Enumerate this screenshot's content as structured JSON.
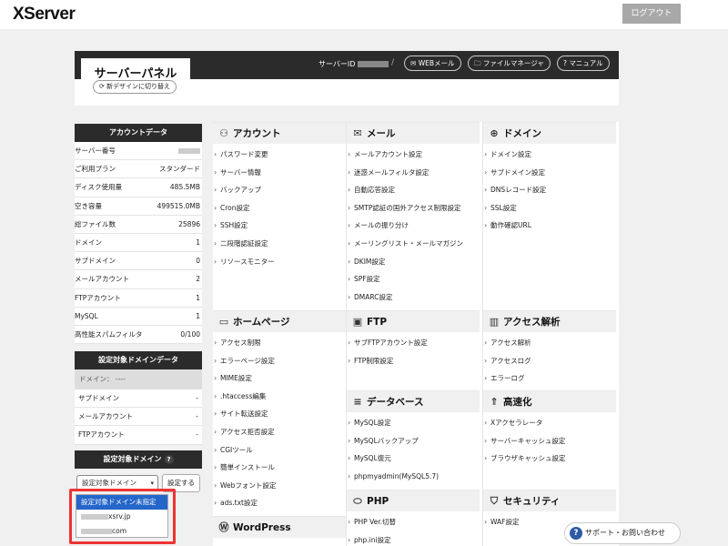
{
  "header": {
    "logo": "XServer",
    "logout_label": "ログアウト"
  },
  "panel": {
    "title": "サーバーパネル",
    "redesign_label": "新デザインに切り替え",
    "server_id_label": "サーバーID",
    "separator": "/",
    "links": [
      {
        "label": "WEBメール",
        "icon": "mail-icon"
      },
      {
        "label": "ファイルマネージャ",
        "icon": "folder-icon"
      },
      {
        "label": "マニュアル",
        "icon": "question-icon"
      }
    ]
  },
  "account_data": {
    "heading": "アカウントデータ",
    "rows": [
      {
        "label": "サーバー番号",
        "value": ""
      },
      {
        "label": "ご利用プラン",
        "value": "スタンダード"
      },
      {
        "label": "ディスク使用量",
        "value": "485.5MB"
      },
      {
        "label": "空き容量",
        "value": "499515.0MB"
      },
      {
        "label": "総ファイル数",
        "value": "25896"
      },
      {
        "label": "ドメイン",
        "value": "1"
      },
      {
        "label": "サブドメイン",
        "value": "0"
      },
      {
        "label": "メールアカウント",
        "value": "2"
      },
      {
        "label": "FTPアカウント",
        "value": "1"
      },
      {
        "label": "MySQL",
        "value": "1"
      },
      {
        "label": "高性能スパムフィルタ",
        "value": "0/100"
      }
    ]
  },
  "target_domain_data": {
    "heading": "設定対象ドメインデータ",
    "domain_label": "ドメイン： ----",
    "rows": [
      {
        "label": "サブドメイン",
        "value": "-"
      },
      {
        "label": "メールアカウント",
        "value": "-"
      },
      {
        "label": "FTPアカウント",
        "value": "-"
      }
    ]
  },
  "target_domain": {
    "heading": "設定対象ドメイン",
    "help_glyph": "?",
    "select_value": "設定対象ドメイン",
    "set_button": "設定する",
    "options": [
      "設定対象ドメイン未指定",
      "xsrv.jp",
      "com"
    ]
  },
  "categories": {
    "account": {
      "title": "アカウント",
      "icon": "person-icon",
      "links": [
        "パスワード変更",
        "サーバー情報",
        "バックアップ",
        "Cron設定",
        "SSH設定",
        "二段階認証設定",
        "リソースモニター"
      ]
    },
    "mail": {
      "title": "メール",
      "icon": "mail-icon",
      "links": [
        "メールアカウント設定",
        "迷惑メールフィルタ設定",
        "自動応答設定",
        "SMTP認証の国外アクセス制限設定",
        "メールの振り分け",
        "メーリングリスト・メールマガジン",
        "DKIM設定",
        "SPF設定",
        "DMARC設定"
      ]
    },
    "domain": {
      "title": "ドメイン",
      "icon": "globe-icon",
      "links": [
        "ドメイン設定",
        "サブドメイン設定",
        "DNSレコード設定",
        "SSL設定",
        "動作確認URL"
      ]
    },
    "homepage": {
      "title": "ホームページ",
      "icon": "window-icon",
      "links": [
        "アクセス制限",
        "エラーページ設定",
        "MIME設定",
        ".htaccess編集",
        "サイト転送設定",
        "アクセス拒否設定",
        "CGIツール",
        "簡単インストール",
        "Webフォント設定",
        "ads.txt設定"
      ]
    },
    "ftp": {
      "title": "FTP",
      "icon": "monitor-icon",
      "links": [
        "サブFTPアカウント設定",
        "FTP制限設定"
      ]
    },
    "analytics": {
      "title": "アクセス解析",
      "icon": "bar-chart-icon",
      "links": [
        "アクセス解析",
        "アクセスログ",
        "エラーログ"
      ]
    },
    "database": {
      "title": "データベース",
      "icon": "database-icon",
      "links": [
        "MySQL設定",
        "MySQLバックアップ",
        "MySQL復元",
        "phpmyadmin(MySQL5.7)"
      ]
    },
    "speed": {
      "title": "高速化",
      "icon": "rocket-icon",
      "links": [
        "Xアクセラレータ",
        "サーバーキャッシュ設定",
        "ブラウザキャッシュ設定"
      ]
    },
    "wordpress": {
      "title": "WordPress",
      "icon": "wordpress-icon",
      "links": []
    },
    "php": {
      "title": "PHP",
      "icon": "php-icon",
      "links": [
        "PHP Ver.切替",
        "php.ini設定"
      ]
    },
    "security": {
      "title": "セキュリティ",
      "icon": "shield-icon",
      "links": [
        "WAF設定"
      ]
    }
  },
  "support": {
    "label": "サポート・お問い合わせ",
    "icon_glyph": "?"
  }
}
